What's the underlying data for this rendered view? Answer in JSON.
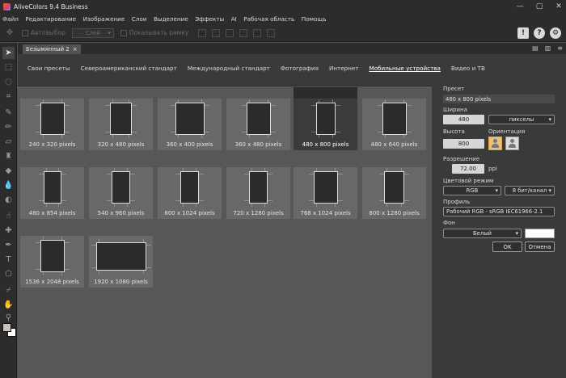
{
  "window": {
    "title": "AliveColors 9.4 Business",
    "controls": [
      "—",
      "▢",
      "✕"
    ]
  },
  "menu": [
    "Файл",
    "Редактирование",
    "Изображение",
    "Слои",
    "Выделение",
    "Эффекты",
    "AI",
    "Рабочая область",
    "Помощь"
  ],
  "options_bar": {
    "autoselect_label": "Автовыбор",
    "layer_select_value": "Слой",
    "show_frame_label": "Показывать рамку"
  },
  "document": {
    "tab_title": "Безымянный 2",
    "close": "×"
  },
  "categories": [
    {
      "label": "Свои пресеты",
      "selected": false
    },
    {
      "label": "Североамериканский стандарт",
      "selected": false
    },
    {
      "label": "Международный стандарт",
      "selected": false
    },
    {
      "label": "Фотография",
      "selected": false
    },
    {
      "label": "Интернет",
      "selected": false
    },
    {
      "label": "Мобильные устройства",
      "selected": true
    },
    {
      "label": "Видео и ТВ",
      "selected": false
    }
  ],
  "presets": [
    {
      "label": "240 x 320 pixels",
      "w": 240,
      "h": 320,
      "selected": false
    },
    {
      "label": "320 x 480 pixels",
      "w": 320,
      "h": 480,
      "selected": false
    },
    {
      "label": "360 x 400 pixels",
      "w": 360,
      "h": 400,
      "selected": false
    },
    {
      "label": "360 x 480 pixels",
      "w": 360,
      "h": 480,
      "selected": false
    },
    {
      "label": "480 x 800 pixels",
      "w": 480,
      "h": 800,
      "selected": true
    },
    {
      "label": "480 x 640 pixels",
      "w": 480,
      "h": 640,
      "selected": false
    },
    {
      "label": "480 x 854 pixels",
      "w": 480,
      "h": 854,
      "selected": false
    },
    {
      "label": "540 x 960 pixels",
      "w": 540,
      "h": 960,
      "selected": false
    },
    {
      "label": "600 x 1024 pixels",
      "w": 600,
      "h": 1024,
      "selected": false
    },
    {
      "label": "720 x 1280 pixels",
      "w": 720,
      "h": 1280,
      "selected": false
    },
    {
      "label": "768 x 1024 pixels",
      "w": 768,
      "h": 1024,
      "selected": false
    },
    {
      "label": "800 x 1280 pixels",
      "w": 800,
      "h": 1280,
      "selected": false
    },
    {
      "label": "1536 x 2048 pixels",
      "w": 1536,
      "h": 2048,
      "selected": false
    },
    {
      "label": "1920 x 1080 pixels",
      "w": 1920,
      "h": 1080,
      "selected": false
    }
  ],
  "settings": {
    "preset_label": "Пресет",
    "preset_value": "480 x 800 pixels",
    "width_label": "Ширина",
    "width_value": "480",
    "units_value": "пикселы",
    "height_label": "Высота",
    "height_value": "800",
    "orientation_label": "Ориентация",
    "resolution_label": "Разрешение",
    "resolution_value": "72.00",
    "resolution_unit": "ppi",
    "color_mode_label": "Цветовой режим",
    "color_mode_value": "RGB",
    "bit_depth_value": "8 бит/канал",
    "profile_label": "Профиль",
    "profile_value": "Рабочий RGB - sRGB IEC61966-2.1",
    "background_label": "Фон",
    "background_value": "Белый",
    "background_color": "#ffffff",
    "ok_label": "OK",
    "cancel_label": "Отмена"
  },
  "colors": {
    "accent_orientation": "#e8a23a",
    "foreground_swatch": "#c8c2b8",
    "background_swatch": "#ffffff"
  }
}
